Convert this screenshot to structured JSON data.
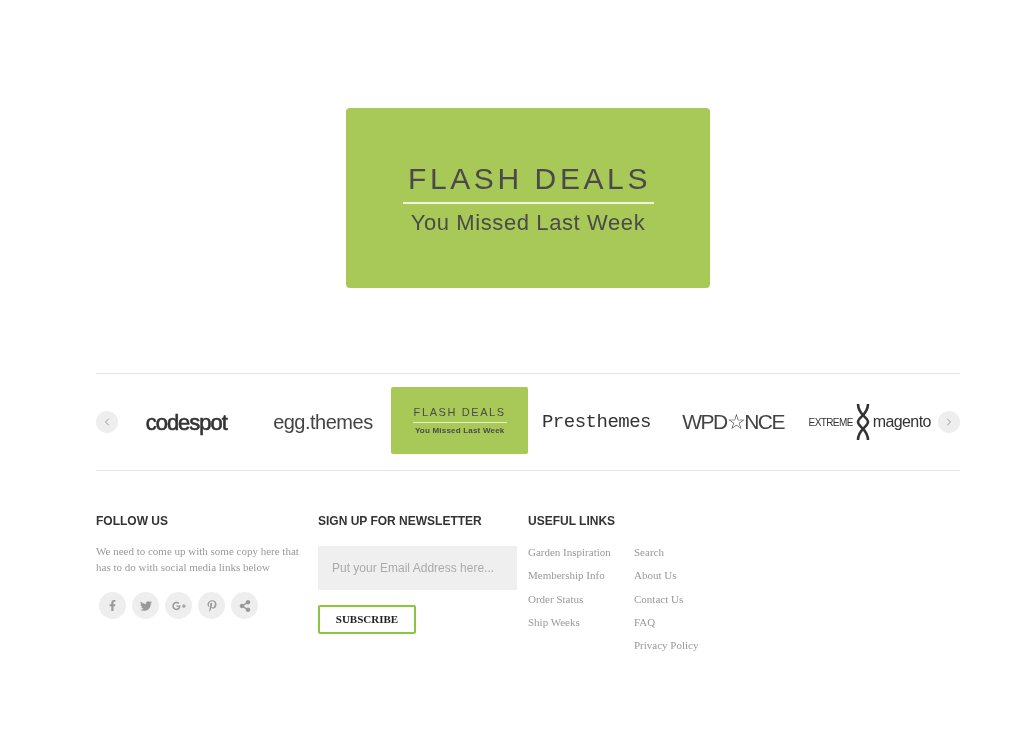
{
  "banner": {
    "title": "FLASH DEALS",
    "subtitle": "You Missed Last Week"
  },
  "brand_carousel": {
    "logos": [
      {
        "kind": "rounded",
        "text": "codespot"
      },
      {
        "kind": "light",
        "text": "egg.themes"
      },
      {
        "kind": "badge",
        "title": "FLASH DEALS",
        "subtitle": "You Missed Last Week"
      },
      {
        "kind": "typewriter",
        "text": "Presthemes"
      },
      {
        "kind": "thin",
        "text": "WPD☆NCE"
      },
      {
        "kind": "emblem",
        "left": "EXTREME",
        "right": "magento"
      }
    ]
  },
  "footer": {
    "follow": {
      "title": "FOLLOW US",
      "text": "We need to come up with some copy here that has to do with social media links below",
      "social": [
        {
          "kind": "facebook"
        },
        {
          "kind": "twitter"
        },
        {
          "kind": "googleplus"
        },
        {
          "kind": "pinterest"
        },
        {
          "kind": "share"
        }
      ]
    },
    "newsletter": {
      "title": "SIGN UP FOR NEWSLETTER",
      "placeholder": "Put your Email Address here...",
      "button": "SUBSCRIBE"
    },
    "useful_links": {
      "title": "USEFUL LINKS",
      "columns": [
        {
          "links": [
            "Garden Inspiration",
            "Membership Info",
            "Order Status",
            "Ship Weeks"
          ]
        },
        {
          "links": [
            "Search",
            "About Us",
            "Contact Us",
            "FAQ",
            "Privacy Policy"
          ]
        }
      ]
    }
  }
}
